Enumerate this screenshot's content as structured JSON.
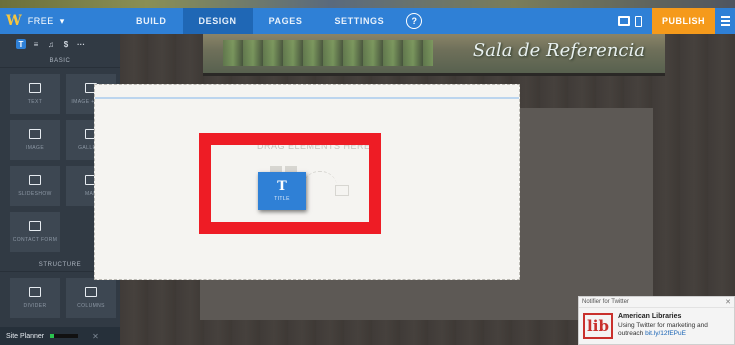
{
  "topbar": {
    "logo": "W",
    "plan": "FREE",
    "tabs": [
      "BUILD",
      "DESIGN",
      "PAGES",
      "SETTINGS"
    ],
    "active_tab": "DESIGN",
    "help": "?",
    "publish": "PUBLISH"
  },
  "sidebar": {
    "tools": [
      "T",
      "≡",
      "♫",
      "$",
      "···"
    ],
    "basic_heading": "BASIC",
    "basic_items": [
      {
        "label": "TEXT",
        "icon": "text-icon"
      },
      {
        "label": "IMAGE + TEXT",
        "icon": "image-text-icon"
      },
      {
        "label": "IMAGE",
        "icon": "image-icon"
      },
      {
        "label": "GALLERY",
        "icon": "gallery-icon"
      },
      {
        "label": "SLIDESHOW",
        "icon": "slideshow-icon"
      },
      {
        "label": "MAP",
        "icon": "map-icon"
      },
      {
        "label": "CONTACT FORM",
        "icon": "form-icon"
      }
    ],
    "structure_heading": "STRUCTURE",
    "structure_items": [
      {
        "label": "DIVIDER",
        "icon": "divider-icon"
      },
      {
        "label": "COLUMNS",
        "icon": "columns-icon"
      }
    ],
    "planner_label": "Site Planner",
    "planner_progress": 0.15,
    "planner_close": "✕"
  },
  "header": {
    "title": "Sala de Referencia"
  },
  "canvas": {
    "drop_text": "DRAG ELEMENTS HERE",
    "dragging_element": {
      "icon": "T",
      "label": "TITLE"
    }
  },
  "notifier": {
    "title": "Notifier for Twitter",
    "close": "✕",
    "logo": "lib",
    "account": "American Libraries",
    "text": "Using Twitter for marketing and outreach",
    "link": "bit.ly/12fEPuE"
  },
  "colors": {
    "brand_blue": "#2f80d6",
    "publish_orange": "#f59a1b",
    "highlight_red": "#ee1c25"
  }
}
